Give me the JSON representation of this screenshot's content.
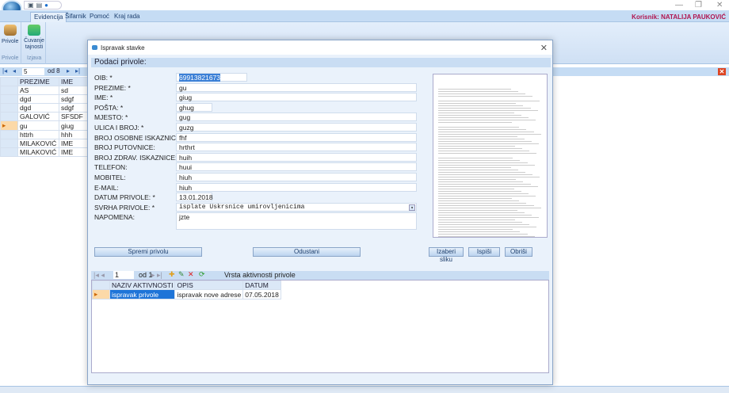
{
  "app": {
    "quick_access": [
      "save-icon",
      "folder-icon",
      "info-icon"
    ],
    "window_controls": [
      "—",
      "❐",
      "✕"
    ]
  },
  "ribbon": {
    "tabs": [
      "Evidencija",
      "Šifarnik",
      "Pomoć",
      "Kraj rada"
    ],
    "active_tab": "Evidencija",
    "user": "Korisnik: NATALIJA PAUKOVIĆ",
    "groups": [
      {
        "label": "Privole",
        "buttons": [
          "Privole"
        ]
      },
      {
        "label": "Izjava",
        "buttons": [
          "Čuvanje tajnosti"
        ]
      }
    ]
  },
  "main_nav": {
    "current": "5",
    "of": "od 8"
  },
  "main_grid": {
    "columns": [
      "PREZIME",
      "IME"
    ],
    "rows": [
      [
        "AS",
        "sd"
      ],
      [
        "dgd",
        "sdgf"
      ],
      [
        "dgd",
        "sdgf"
      ],
      [
        "GALOVIĆ",
        "SFSDF"
      ],
      [
        "gu",
        "giug"
      ],
      [
        "httrh",
        "hhh"
      ],
      [
        "MILAKOVIĆ",
        "IME"
      ],
      [
        "MILAKOVIĆ",
        "IME"
      ]
    ],
    "selected_row": 4
  },
  "dialog": {
    "title": "Ispravak stavke",
    "section": "Podaci privole:",
    "fields": [
      {
        "label": "OIB: *",
        "value": "69913821673"
      },
      {
        "label": "PREZIME: *",
        "value": "gu"
      },
      {
        "label": "IME: *",
        "value": "giug"
      },
      {
        "label": "POŠTA: *",
        "value": "ghug"
      },
      {
        "label": "MJESTO: *",
        "value": "gug"
      },
      {
        "label": "ULICA I BROJ: *",
        "value": "guzg"
      },
      {
        "label": "BROJ OSOBNE ISKAZNICE:",
        "value": "fhf"
      },
      {
        "label": "BROJ PUTOVNICE:",
        "value": "hrthrt"
      },
      {
        "label": "BROJ ZDRAV. ISKAZNICE:",
        "value": "huih"
      },
      {
        "label": "TELEFON:",
        "value": "huui"
      },
      {
        "label": "MOBITEL:",
        "value": "hiuh"
      },
      {
        "label": "E-MAIL:",
        "value": "hiuh"
      },
      {
        "label": "DATUM PRIVOLE: *",
        "value": "13.01.2018"
      },
      {
        "label": "SVRHA PRIVOLE: *",
        "value": "isplate Uskrsnice umirovljenicima"
      },
      {
        "label": "NAPOMENA:",
        "value": "jzte"
      }
    ],
    "buttons": {
      "save": "Spremi privolu",
      "cancel": "Odustani",
      "choose_image": "Izaberi sliku",
      "print": "Ispiši",
      "delete": "Obriši"
    },
    "activity_nav": {
      "current": "1",
      "of": "od 1",
      "title": "Vrsta aktivnosti privole"
    },
    "activity_grid": {
      "columns": [
        "NAZIV AKTIVNOSTI",
        "OPIS",
        "DATUM"
      ],
      "rows": [
        [
          "ispravak privole",
          "ispravak nove adrese",
          "07.05.2018"
        ]
      ]
    }
  }
}
